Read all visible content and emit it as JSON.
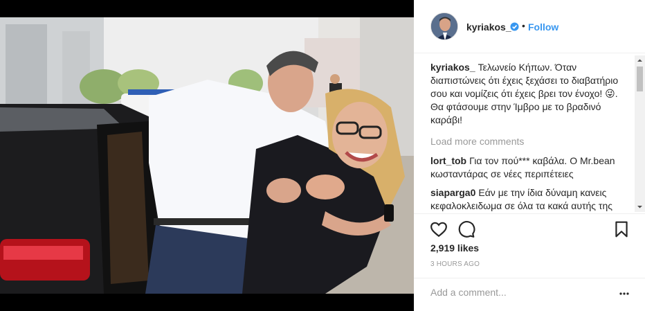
{
  "post": {
    "username": "kyriakos_",
    "verified_icon": "verified-badge-icon",
    "separator": "•",
    "follow_label": "Follow",
    "caption_user": "kyriakos_",
    "caption_text": "Τελωνείο Κήπων. Όταν διαπιστώνεις ότι έχεις ξεχάσει το διαβατήριο σου και νομίζεις ότι έχεις βρει τον ένοχο! 😜. Θα φτάσουμε στην Ίμβρο με το βραδινό καράβι!",
    "load_more": "Load more comments",
    "comments": [
      {
        "user": "lort_tob",
        "text": "Για τον πού*** καβάλα. Ο Mr.bean κωσταντάρας σε νέες περιπέτειες"
      },
      {
        "user": "siaparga0",
        "text": "Εάν με την ίδια δύναμη κανεις κεφαλοκλειδωμα σε όλα τα κακά αυτής της χώρας,καλά θα πάμε ."
      }
    ],
    "likes": "2,919 likes",
    "time": "3 HOURS AGO",
    "add_comment_placeholder": "Add a comment...",
    "icons": {
      "like": "heart-icon",
      "comment": "comment-bubble-icon",
      "save": "bookmark-icon",
      "more": "more-dots-icon"
    },
    "colors": {
      "accent": "#3897f0",
      "text": "#262626",
      "muted": "#999999",
      "divider": "#efefef"
    }
  }
}
